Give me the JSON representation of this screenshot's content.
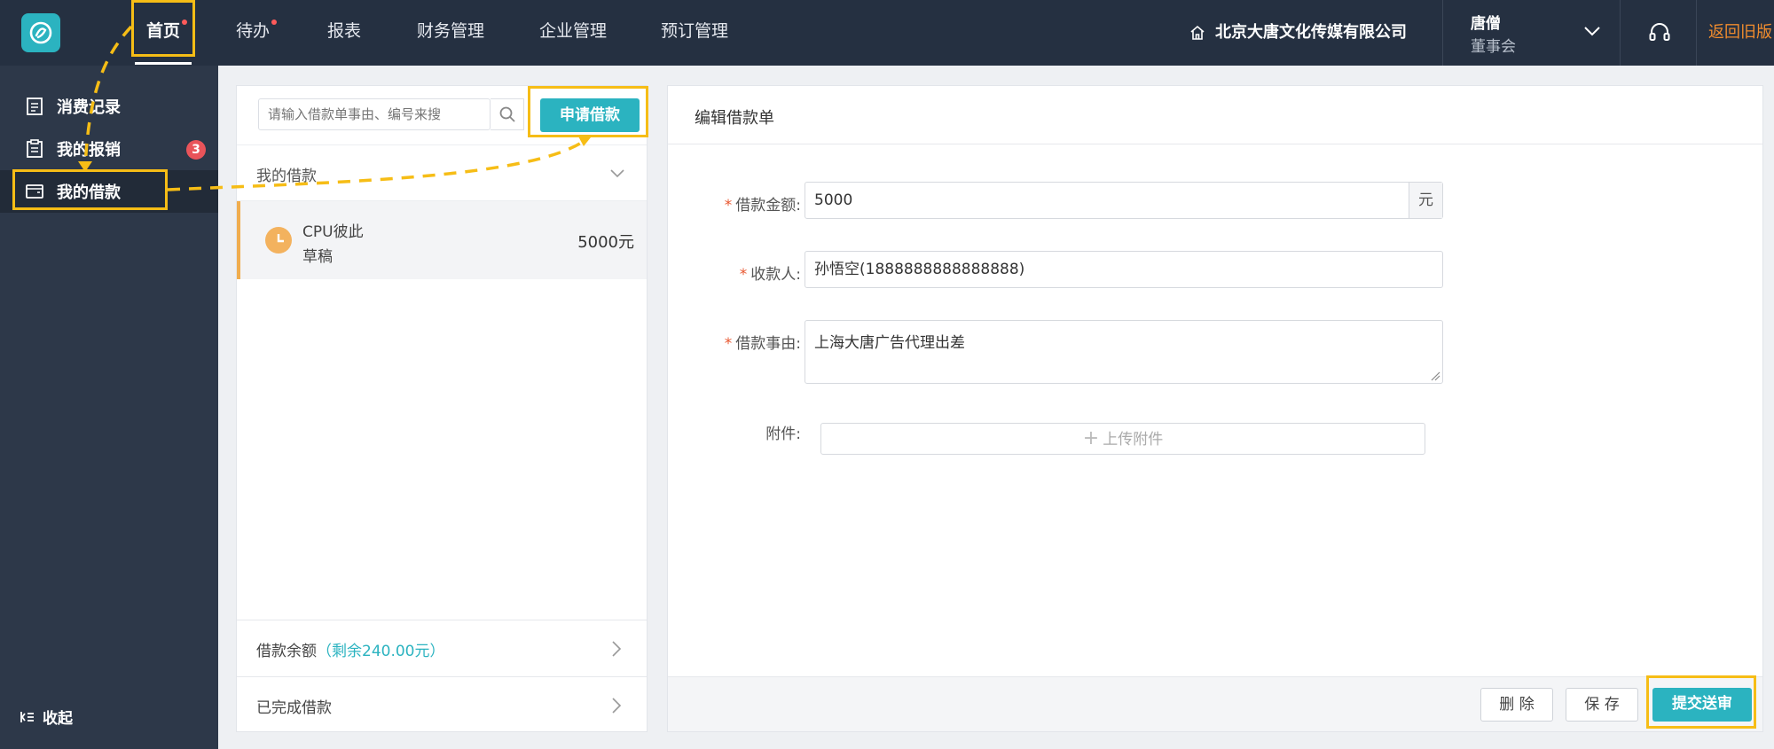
{
  "topbar": {
    "nav": [
      {
        "label": "首页",
        "active": true,
        "dot": true
      },
      {
        "label": "待办",
        "active": false,
        "dot": true
      },
      {
        "label": "报表",
        "active": false,
        "dot": false
      },
      {
        "label": "财务管理",
        "active": false,
        "dot": false
      },
      {
        "label": "企业管理",
        "active": false,
        "dot": false
      },
      {
        "label": "预订管理",
        "active": false,
        "dot": false
      }
    ],
    "company": "北京大唐文化传媒有限公司",
    "user_name": "唐僧",
    "user_role": "董事会",
    "return_old": "返回旧版"
  },
  "sidebar": {
    "items": [
      {
        "label": "消费记录",
        "icon": "document-icon"
      },
      {
        "label": "我的报销",
        "icon": "clipboard-icon",
        "badge": "3"
      },
      {
        "label": "我的借款",
        "icon": "wallet-icon",
        "active": true
      }
    ],
    "collapse_label": "收起"
  },
  "list": {
    "search_placeholder": "请输入借款单事由、编号来搜",
    "apply_button": "申请借款",
    "section_title": "我的借款",
    "items": [
      {
        "name": "CPU彼此",
        "status": "草稿",
        "amount": "5000元"
      }
    ],
    "balance_label": "借款余额",
    "balance_note": "（剩余240.00元）",
    "completed_label": "已完成借款"
  },
  "form": {
    "title": "编辑借款单",
    "amount_label": "借款金额:",
    "amount_value": "5000",
    "amount_unit": "元",
    "payee_label": "收款人:",
    "payee_value": "孙悟空(1888888888888888)",
    "reason_label": "借款事由:",
    "reason_value": "上海大唐广告代理出差",
    "attachment_label": "附件:",
    "upload_label": "上传附件",
    "delete_button": "删 除",
    "save_button": "保 存",
    "submit_button": "提交送审"
  },
  "colors": {
    "accent": "#2bb3c0",
    "topbar": "#253041",
    "sidebar": "#2d3849",
    "highlight": "#f6bd16",
    "required": "#e8562f",
    "return_link": "#f08c2e"
  }
}
